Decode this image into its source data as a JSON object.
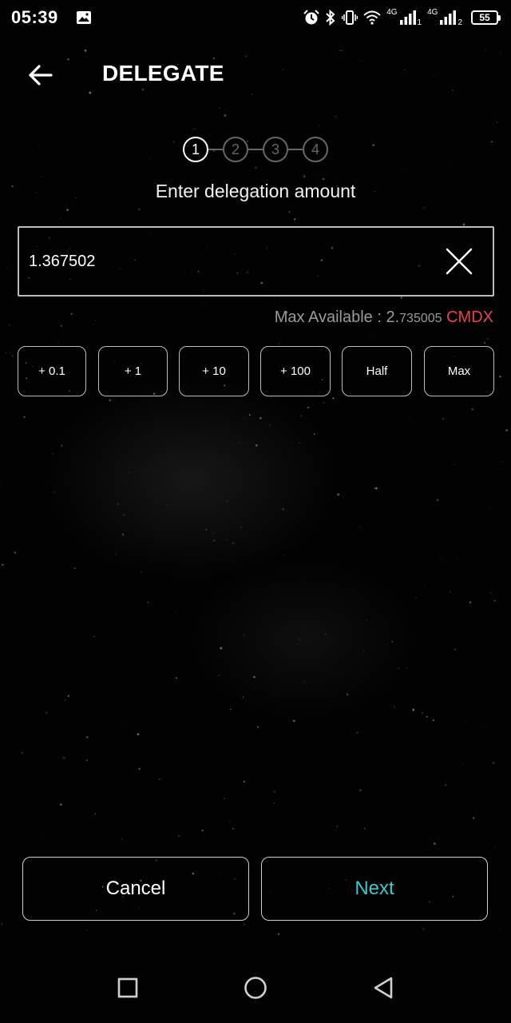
{
  "status_bar": {
    "time": "05:39",
    "net_1": "4G",
    "net_2": "4G",
    "sim_1": "1",
    "sim_2": "2",
    "battery": "55",
    "icons": [
      "gallery-icon",
      "alarm-icon",
      "bluetooth-icon",
      "vibrate-icon",
      "wifi-icon",
      "signal-icon",
      "battery-icon"
    ]
  },
  "header": {
    "title": "DELEGATE",
    "back_icon": "arrow-left-icon"
  },
  "stepper": {
    "steps": [
      "1",
      "2",
      "3",
      "4"
    ],
    "active": 1,
    "label": "Enter delegation amount"
  },
  "amount": {
    "value": "1.367502",
    "clear_icon": "close-icon"
  },
  "max_available": {
    "label": "Max Available : 2.",
    "amount": "735005",
    "denom": " CMDX"
  },
  "quick_buttons": [
    "+ 0.1",
    "+ 1",
    "+ 10",
    "+ 100",
    "Half",
    "Max"
  ],
  "actions": {
    "cancel_label": "Cancel",
    "next_label": "Next"
  },
  "nav": {
    "icons": [
      "recent-apps-icon",
      "home-icon",
      "back-triangle-icon"
    ]
  },
  "colors": {
    "background": "#000000",
    "accent_next": "#3cc6d0",
    "denom": "#e8434d",
    "muted": "#9a9a9a"
  }
}
